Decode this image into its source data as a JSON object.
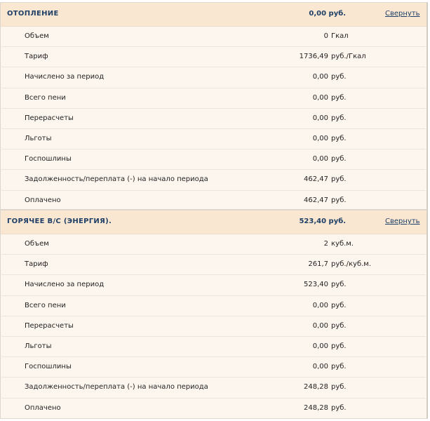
{
  "sections": [
    {
      "title": "ОТОПЛЕНИЕ",
      "total": "0,00 руб.",
      "toggle": "Свернуть",
      "rows": [
        {
          "label": "Объем",
          "value": "0",
          "unit": "Гкал"
        },
        {
          "label": "Тариф",
          "value": "1736,49",
          "unit": "руб./Гкал"
        },
        {
          "label": "Начислено за период",
          "value": "0,00",
          "unit": "руб."
        },
        {
          "label": "Всего пени",
          "value": "0,00",
          "unit": "руб."
        },
        {
          "label": "Перерасчеты",
          "value": "0,00",
          "unit": "руб."
        },
        {
          "label": "Льготы",
          "value": "0,00",
          "unit": "руб."
        },
        {
          "label": "Госпошлины",
          "value": "0,00",
          "unit": "руб."
        },
        {
          "label": "Задолженность/переплата (-) на начало периода",
          "value": "462,47",
          "unit": "руб."
        },
        {
          "label": "Оплачено",
          "value": "462,47",
          "unit": "руб."
        }
      ]
    },
    {
      "title": "ГОРЯЧЕЕ В/С (ЭНЕРГИЯ).",
      "total": "523,40 руб.",
      "toggle": "Свернуть",
      "rows": [
        {
          "label": "Объем",
          "value": "2",
          "unit": "куб.м."
        },
        {
          "label": "Тариф",
          "value": "261,7",
          "unit": "руб./куб.м."
        },
        {
          "label": "Начислено за период",
          "value": "523,40",
          "unit": "руб."
        },
        {
          "label": "Всего пени",
          "value": "0,00",
          "unit": "руб."
        },
        {
          "label": "Перерасчеты",
          "value": "0,00",
          "unit": "руб."
        },
        {
          "label": "Льготы",
          "value": "0,00",
          "unit": "руб."
        },
        {
          "label": "Госпошлины",
          "value": "0,00",
          "unit": "руб."
        },
        {
          "label": "Задолженность/переплата (-) на начало периода",
          "value": "248,28",
          "unit": "руб."
        },
        {
          "label": "Оплачено",
          "value": "248,28",
          "unit": "руб."
        }
      ]
    }
  ]
}
